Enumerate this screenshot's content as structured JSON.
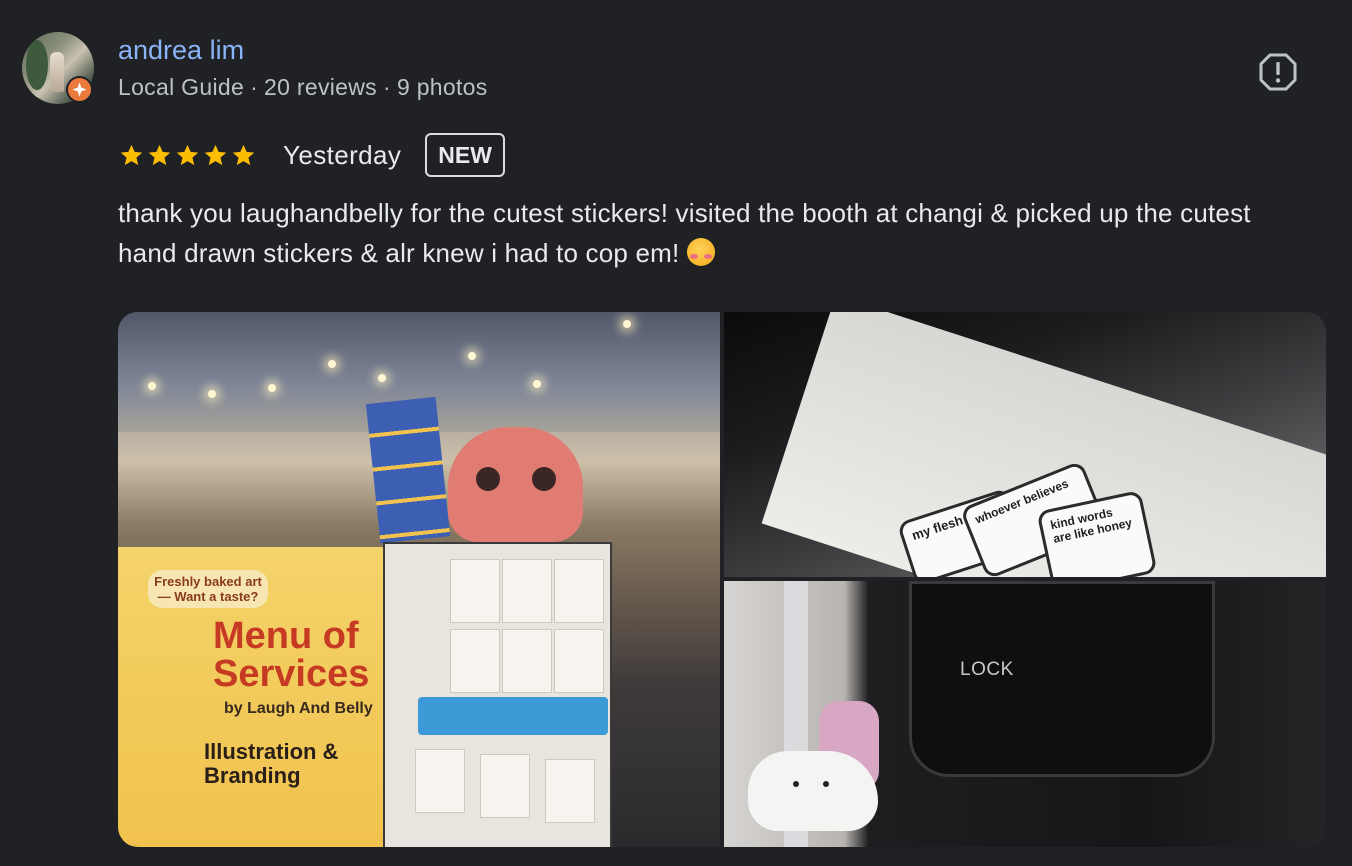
{
  "reviewer": {
    "name": "andrea lim",
    "level": "Local Guide",
    "separator": "·",
    "reviews": "20 reviews",
    "photos": "9 photos",
    "badge_icon": "local-guide-star-icon",
    "badge_color": "#ea7a3b"
  },
  "review": {
    "rating": 5,
    "rating_max": 5,
    "star_color": "#fbbc04",
    "date": "Yesterday",
    "badge": "NEW",
    "text": "thank you laughandbelly for the cutest stickers! visited the booth at changi & picked up the cutest hand drawn stickers & alr knew i had to cop em!",
    "emoji": "smiling-face-with-hearts"
  },
  "photos": {
    "booth": {
      "sign_text": "Menu of Services",
      "sign_sub": "by Laugh And Belly",
      "sign_bubble": "Freshly baked art — Want a taste?",
      "sign_section": "Illustration & Branding"
    },
    "stickers": {
      "s1": "my flesh",
      "s2": "whoever believes",
      "s3": "kind words are like honey"
    },
    "appliance": {
      "panel_text": "LOCK"
    }
  },
  "actions": {
    "report_icon": "report-icon"
  },
  "colors": {
    "background": "#202124",
    "name": "#8ab4f8",
    "text": "#e8eaed",
    "meta": "#bdc1c6"
  }
}
